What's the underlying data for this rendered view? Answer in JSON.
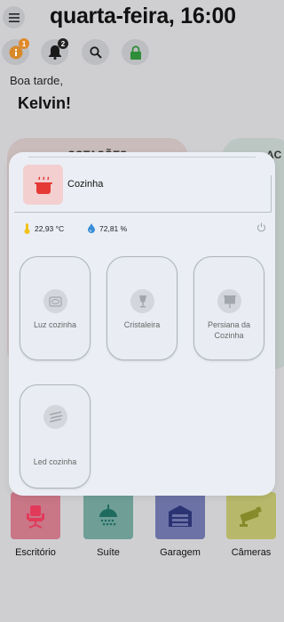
{
  "header": {
    "time": "quarta-feira, 16:00"
  },
  "chips": [
    {
      "icon": "info-icon",
      "badge": "1",
      "badge_color": "#e0892a"
    },
    {
      "icon": "bell-icon",
      "badge": "2",
      "badge_color": "#222222"
    },
    {
      "icon": "search-icon",
      "badge": ""
    },
    {
      "icon": "lock-icon",
      "badge": ""
    }
  ],
  "greeting": {
    "line": "Boa tarde,",
    "name": "Kelvin!"
  },
  "background_cards": {
    "left_title": "COTAÇÕES",
    "right_title": "AC"
  },
  "rooms": [
    {
      "label": "Escritório",
      "color": "#c97687",
      "icon": "chair-icon"
    },
    {
      "label": "Suíte",
      "color": "#6f9e97",
      "icon": "shower-icon"
    },
    {
      "label": "Garagem",
      "color": "#6d72a6",
      "icon": "garage-icon"
    },
    {
      "label": "Câmeras",
      "color": "#b8b86a",
      "icon": "camera-icon"
    }
  ],
  "modal": {
    "room_name": "Cozinha",
    "room_icon_color": "#e53935",
    "temperature": "22,93 °C",
    "humidity": "72,81 %",
    "devices": [
      {
        "name": "Luz cozinha",
        "icon": "light-icon"
      },
      {
        "name": "Cristaleira",
        "icon": "lamp-icon"
      },
      {
        "name": "Persiana da Cozinha",
        "icon": "blinds-icon"
      },
      {
        "name": "Led cozinha",
        "icon": "led-strip-icon"
      }
    ]
  }
}
